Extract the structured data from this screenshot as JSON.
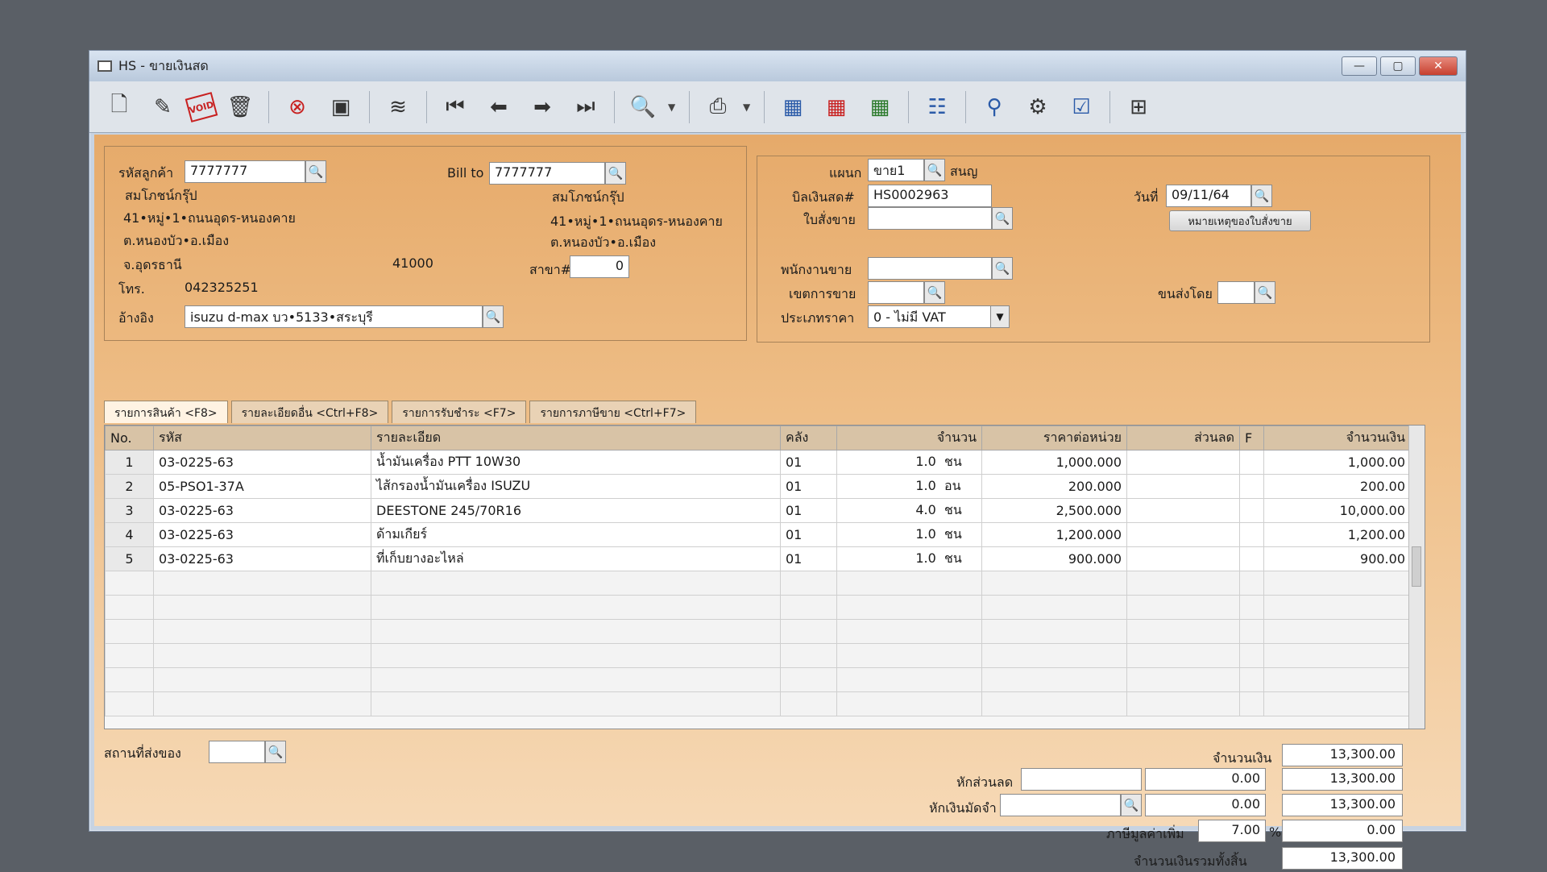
{
  "window": {
    "title": "HS - ขายเงินสด",
    "minimize": "—",
    "maximize": "▢",
    "close": "✕"
  },
  "toolbar": {
    "icons": [
      "new-document-icon",
      "edit-icon",
      "void-icon",
      "delete-bin-icon",
      "cancel-icon",
      "save-icon",
      "stack-icon",
      "first-record-icon",
      "previous-record-icon",
      "next-record-icon",
      "last-record-icon",
      "search-doc-icon",
      "printer-icon",
      "calculator-icon",
      "calculator-2-icon",
      "calculator-green-icon",
      "form-icon",
      "approve-icon",
      "bike-icon",
      "ok-icon",
      "network-icon"
    ],
    "void_label": "VOID"
  },
  "customer": {
    "code_label": "รหัสลูกค้า",
    "code_value": "7777777",
    "name": "สมโภชน์กรุ๊ป",
    "addr1": "41•หมู่•1•ถนนอุดร-หนองคาย",
    "addr2": "ต.หนองบัว•อ.เมือง",
    "province": "จ.อุดรธานี",
    "zip": "41000",
    "phone_label": "โทร.",
    "phone": "042325251",
    "ref_label": "อ้างอิง",
    "ref_value": "isuzu d-max บว•5133•สระบุรี"
  },
  "bill_to": {
    "label": "Bill to",
    "value": "7777777",
    "name": "สมโภชน์กรุ๊ป",
    "addr1": "41•หมู่•1•ถนนอุดร-หนองคาย",
    "addr2": "ต.หนองบัว•อ.เมือง",
    "branch_label": "สาขา#",
    "branch_value": "0"
  },
  "doc": {
    "dept_label": "แผนก",
    "dept_value": "ขาย1",
    "dept_name": "สนญ",
    "bill_label": "บิลเงินสด#",
    "bill_value": "HS0002963",
    "order_label": "ใบสั่งขาย",
    "order_value": "",
    "date_label": "วันที่",
    "date_value": "09/11/64",
    "note_button": "หมายเหตุของใบสั่งขาย",
    "salesman_label": "พนักงานขาย",
    "salesman_value": "",
    "area_label": "เขตการขาย",
    "area_value": "",
    "shipper_label": "ขนส่งโดย",
    "shipper_value": "",
    "pricetype_label": "ประเภทราคา",
    "pricetype_value": "0 - ไม่มี VAT"
  },
  "tabs": [
    {
      "label": "รายการสินค้า <F8>"
    },
    {
      "label": "รายละเอียดอื่น <Ctrl+F8>"
    },
    {
      "label": "รายการรับชำระ <F7>"
    },
    {
      "label": "รายการภาษีขาย <Ctrl+F7>"
    }
  ],
  "grid": {
    "headers": {
      "no": "No.",
      "code": "รหัส",
      "desc": "รายละเอียด",
      "wh": "คลัง",
      "qty": "จำนวน",
      "price": "ราคาต่อหน่วย",
      "disc": "ส่วนลด",
      "f": "F",
      "amount": "จำนวนเงิน"
    },
    "rows": [
      {
        "no": "1",
        "code": "03-0225-63",
        "desc": "น้ำมันเครื่อง PTT 10W30",
        "wh": "01",
        "qty": "1.0",
        "unit": "ชน",
        "price": "1,000.000",
        "disc": "",
        "f": "",
        "amount": "1,000.00"
      },
      {
        "no": "2",
        "code": "05-PSO1-37A",
        "desc": "ไส้กรองน้ำมันเครื่อง ISUZU",
        "wh": "01",
        "qty": "1.0",
        "unit": "อน",
        "price": "200.000",
        "disc": "",
        "f": "",
        "amount": "200.00"
      },
      {
        "no": "3",
        "code": "03-0225-63",
        "desc": "DEESTONE 245/70R16",
        "wh": "01",
        "qty": "4.0",
        "unit": "ชน",
        "price": "2,500.000",
        "disc": "",
        "f": "",
        "amount": "10,000.00"
      },
      {
        "no": "4",
        "code": "03-0225-63",
        "desc": "ด้ามเกียร์",
        "wh": "01",
        "qty": "1.0",
        "unit": "ชน",
        "price": "1,200.000",
        "disc": "",
        "f": "",
        "amount": "1,200.00"
      },
      {
        "no": "5",
        "code": "03-0225-63",
        "desc": "ที่เก็บยางอะไหล่",
        "wh": "01",
        "qty": "1.0",
        "unit": "ชน",
        "price": "900.000",
        "disc": "",
        "f": "",
        "amount": "900.00"
      }
    ]
  },
  "footer": {
    "ship_label": "สถานที่ส่งของ",
    "ship_value": "",
    "amount_label": "จำนวนเงิน",
    "amount_value": "13,300.00",
    "discount_label": "หักส่วนลด",
    "discount_input": "",
    "discount_value": "0.00",
    "discount_total": "13,300.00",
    "deposit_label": "หักเงินมัดจำ",
    "deposit_input": "",
    "deposit_value": "0.00",
    "deposit_total": "13,300.00",
    "vat_label": "ภาษีมูลค่าเพิ่ม",
    "vat_rate": "7.00",
    "vat_pct": "%",
    "vat_value": "0.00",
    "grand_label": "จำนวนเงินรวมทั้งสิ้น",
    "grand_value": "13,300.00"
  }
}
